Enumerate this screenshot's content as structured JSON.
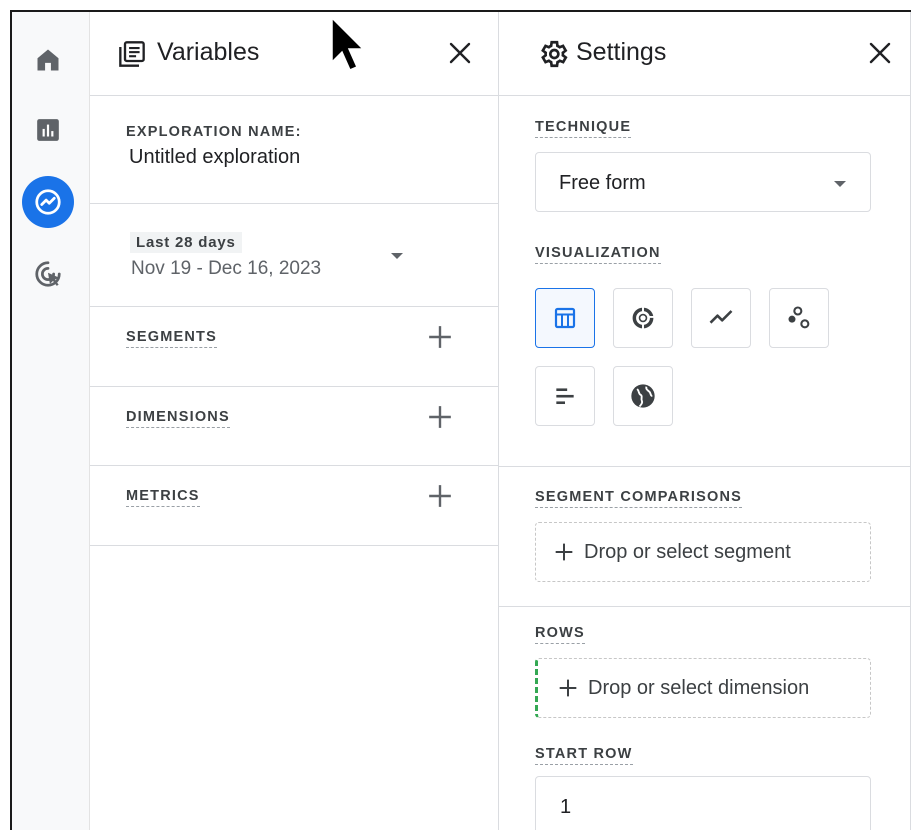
{
  "rail": {
    "items": [
      {
        "icon": "home-icon",
        "active": false
      },
      {
        "icon": "reports-icon",
        "active": false
      },
      {
        "icon": "explore-icon",
        "active": true
      },
      {
        "icon": "advertising-icon",
        "active": false
      }
    ]
  },
  "variables": {
    "title": "Variables",
    "exploration_name_label": "EXPLORATION NAME:",
    "exploration_name_value": "Untitled exploration",
    "date_badge": "Last 28 days",
    "date_range": "Nov 19 - Dec 16, 2023",
    "segments_label": "SEGMENTS",
    "dimensions_label": "DIMENSIONS",
    "metrics_label": "METRICS"
  },
  "settings": {
    "title": "Settings",
    "technique_label": "TECHNIQUE",
    "technique_value": "Free form",
    "visualization_label": "VISUALIZATION",
    "visualizations": [
      {
        "icon": "table-icon",
        "selected": true
      },
      {
        "icon": "donut-chart-icon",
        "selected": false
      },
      {
        "icon": "line-chart-icon",
        "selected": false
      },
      {
        "icon": "scatter-plot-icon",
        "selected": false
      },
      {
        "icon": "bar-chart-icon",
        "selected": false
      },
      {
        "icon": "geo-map-icon",
        "selected": false
      }
    ],
    "segment_comparisons_label": "SEGMENT COMPARISONS",
    "segment_drop_label": "Drop or select segment",
    "rows_label": "ROWS",
    "rows_drop_label": "Drop or select dimension",
    "start_row_label": "START ROW",
    "start_row_value": "1"
  },
  "colors": {
    "accent": "#1a73e8",
    "rail_bg": "#f8f9fa",
    "border": "#dadce0",
    "drop_indicator": "#34a853"
  }
}
